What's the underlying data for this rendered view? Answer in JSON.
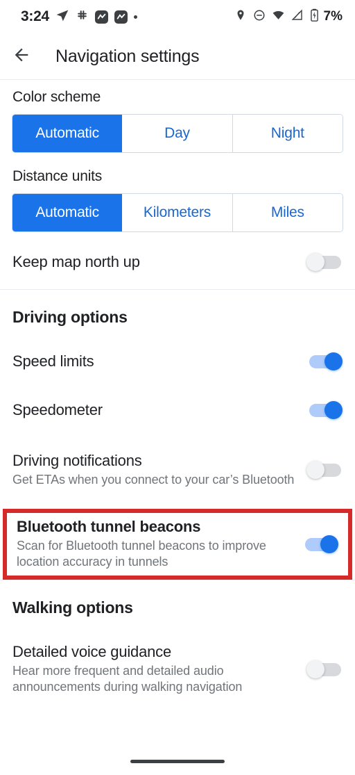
{
  "status_bar": {
    "clock": "3:24",
    "battery_percent": "7%",
    "left_icons": [
      "navigation-arrow-icon",
      "slack-icon",
      "app-badge-icon",
      "app-badge-icon",
      "dot-icon"
    ],
    "right_icons": [
      "location-pin-icon",
      "do-not-disturb-icon",
      "wifi-icon",
      "mobile-signal-icon",
      "battery-icon"
    ]
  },
  "app_bar": {
    "back_icon": "back-arrow-icon",
    "title": "Navigation settings"
  },
  "settings": {
    "color_scheme": {
      "label": "Color scheme",
      "options": [
        "Automatic",
        "Day",
        "Night"
      ],
      "selected": "Automatic"
    },
    "distance_units": {
      "label": "Distance units",
      "options": [
        "Automatic",
        "Kilometers",
        "Miles"
      ],
      "selected": "Automatic"
    },
    "keep_map_north_up": {
      "title": "Keep map north up",
      "state": "off"
    },
    "driving_options": {
      "header": "Driving options",
      "items": [
        {
          "title": "Speed limits",
          "subtitle": "",
          "state": "on"
        },
        {
          "title": "Speedometer",
          "subtitle": "",
          "state": "on"
        },
        {
          "title": "Driving notifications",
          "subtitle": "Get ETAs when you connect to your car’s Bluetooth",
          "state": "off"
        },
        {
          "title": "Bluetooth tunnel beacons",
          "subtitle": "Scan for Bluetooth tunnel beacons to improve location accuracy in tunnels",
          "state": "on",
          "highlighted": true
        }
      ]
    },
    "walking_options": {
      "header": "Walking options",
      "items": [
        {
          "title": "Detailed voice guidance",
          "subtitle": "Hear more frequent and detailed audio announcements during walking navigation",
          "state": "off"
        }
      ]
    }
  },
  "colors": {
    "accent_blue": "#1a73e8",
    "link_blue": "#1967d2",
    "toggle_on_track": "#aecbfa",
    "highlight_red": "#d42a2a",
    "text_primary": "#202124",
    "text_secondary": "#70757a"
  },
  "gesture_bar": {
    "name": "home-gesture-bar"
  }
}
